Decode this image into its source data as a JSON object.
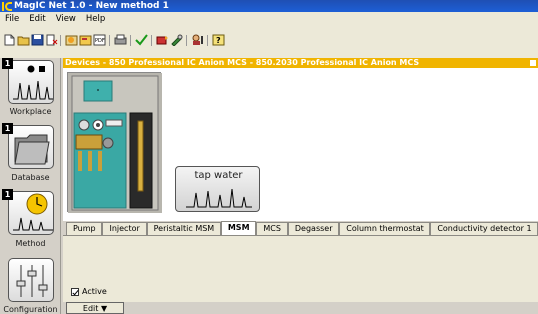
{
  "window": {
    "title": "MagIC Net 1.0 - New method 1"
  },
  "menu": {
    "items": [
      "File",
      "Edit",
      "View",
      "Help"
    ]
  },
  "nav": {
    "items": [
      {
        "label": "Workplace",
        "badge": "1"
      },
      {
        "label": "Database",
        "badge": "1"
      },
      {
        "label": "Method",
        "badge": "1"
      },
      {
        "label": "Configuration"
      }
    ]
  },
  "devices": {
    "header": "Devices - 850 Professional IC Anion MCS - 850.2030 Professional IC Anion MCS",
    "sample_label": "tap water"
  },
  "tabs": {
    "items": [
      "Pump",
      "Injector",
      "Peristaltic MSM",
      "MSM",
      "MCS",
      "Degasser",
      "Column thermostat",
      "Conductivity detector 1"
    ],
    "selected": "MSM"
  },
  "settings": {
    "active_label": "Active",
    "active_checked": true
  },
  "edit": {
    "button_label": "Edit ▼"
  },
  "colors": {
    "title_blue": "#1d5fd6",
    "device_header": "#f0b400",
    "instrument_teal": "#3aa8a4"
  }
}
